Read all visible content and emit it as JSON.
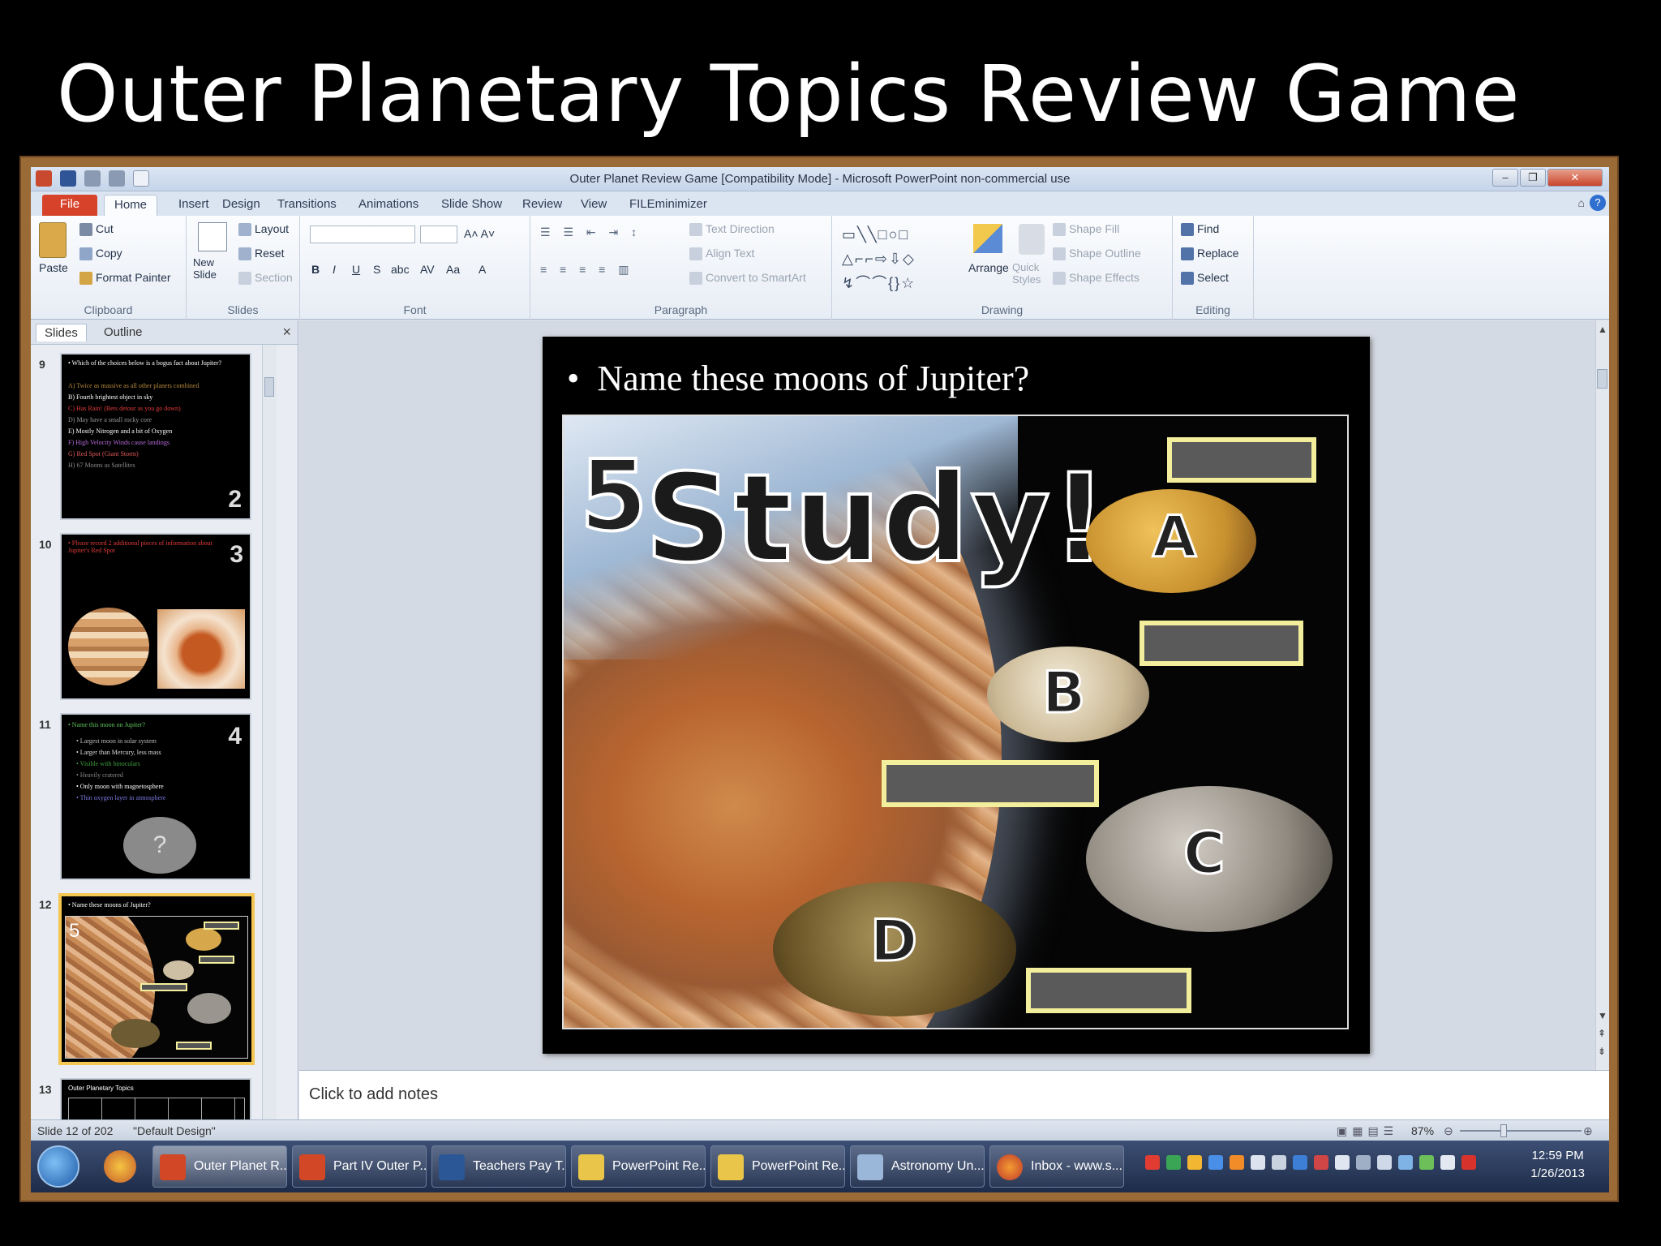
{
  "page_title": "Outer Planetary Topics Review Game",
  "window": {
    "title": "Outer Planet Review Game [Compatibility Mode] - Microsoft PowerPoint non-commercial use",
    "controls": [
      "–",
      "❐",
      "✕"
    ]
  },
  "ribbon_tabs": [
    "File",
    "Home",
    "Insert",
    "Design",
    "Transitions",
    "Animations",
    "Slide Show",
    "Review",
    "View",
    "FILEminimizer"
  ],
  "ribbon": {
    "clipboard": {
      "paste": "Paste",
      "cut": "Cut",
      "copy": "Copy",
      "format_painter": "Format Painter",
      "label": "Clipboard"
    },
    "slides": {
      "new_slide": "New Slide",
      "layout": "Layout",
      "reset": "Reset",
      "section": "Section",
      "label": "Slides"
    },
    "font": {
      "label": "Font",
      "bold": "B",
      "italic": "I",
      "underline": "U",
      "strike": "S",
      "shadow": "abc",
      "spacing": "AV",
      "case": "Aa",
      "color": "A"
    },
    "paragraph": {
      "label": "Paragraph",
      "text_direction": "Text Direction",
      "align_text": "Align Text",
      "convert_smartart": "Convert to SmartArt"
    },
    "drawing": {
      "label": "Drawing",
      "arrange": "Arrange",
      "quick_styles": "Quick Styles",
      "shape_fill": "Shape Fill",
      "shape_outline": "Shape Outline",
      "shape_effects": "Shape Effects"
    },
    "editing": {
      "label": "Editing",
      "find": "Find",
      "replace": "Replace",
      "select": "Select"
    }
  },
  "panel_tabs": {
    "slides": "Slides",
    "outline": "Outline",
    "close": "×"
  },
  "thumbnails": [
    {
      "num": "9",
      "badge": "2",
      "lines": [
        "• Which of the choices below is a bogus fact about Jupiter?",
        "A) Twice as massive as all other planets combined",
        "B) Fourth brightest object in sky",
        "C) Has Rain! (Bets detour as you go down)",
        "D) May have a small rocky core",
        "E) Mostly Nitrogen and a bit of Oxygen",
        "F) High Velocity Winds cause landings",
        "G) Red Spot (Giant Storm)",
        "H) 67 Moons as Satellites"
      ]
    },
    {
      "num": "10",
      "badge": "3",
      "lines": [
        "• Please record 2 additional pieces of information about Jupiter's Red Spot"
      ]
    },
    {
      "num": "11",
      "badge": "4",
      "lines": [
        "• Name this moon on Jupiter?",
        "• Largest moon in solar system",
        "• Larger than Mercury, less mass",
        "• Visible with binoculars",
        "• Heavily cratered",
        "• Only moon with magnetosphere",
        "• Thin oxygen layer in atmosphere"
      ],
      "moon_mark": "?"
    },
    {
      "num": "12",
      "badge": "5",
      "lines": [
        "• Name these moons of Jupiter?"
      ]
    },
    {
      "num": "13",
      "lines": [
        "Outer Planetary Topics"
      ]
    }
  ],
  "slide": {
    "bullet": "Name these moons of Jupiter?",
    "number": "5",
    "study": "Study!",
    "moons": [
      "A",
      "B",
      "C",
      "D"
    ]
  },
  "notes_placeholder": "Click to add notes",
  "status": {
    "slide": "Slide 12 of 202",
    "theme": "\"Default Design\"",
    "zoom": "87%"
  },
  "taskbar": {
    "items": [
      "Outer Planet R...",
      "Part IV Outer P...",
      "Teachers Pay T...",
      "PowerPoint Re...",
      "PowerPoint Re...",
      "Astronomy Un...",
      "Inbox - www.s..."
    ],
    "time": "12:59 PM",
    "date": "1/26/2013"
  }
}
